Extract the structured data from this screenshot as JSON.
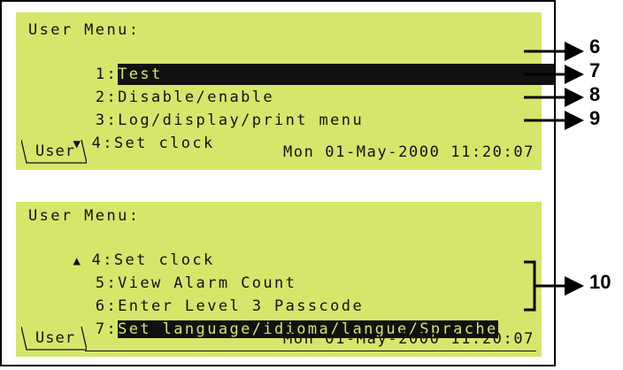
{
  "screen1": {
    "title": "User Menu:",
    "items": [
      {
        "num": "1:",
        "label": "Test",
        "selected": true
      },
      {
        "num": "2:",
        "label": "Disable/enable"
      },
      {
        "num": "3:",
        "label": "Log/display/print menu"
      },
      {
        "num": "4:",
        "label": "Set clock",
        "indicator": "▼"
      }
    ],
    "tab": "User",
    "datetime": "Mon 01-May-2000 11:20:07"
  },
  "screen2": {
    "title": "User Menu:",
    "items": [
      {
        "num": "4:",
        "label": "Set clock",
        "indicator": "▲"
      },
      {
        "num": "5:",
        "label": "View Alarm Count"
      },
      {
        "num": "6:",
        "label": "Enter Level 3 Passcode"
      },
      {
        "num": "7:",
        "label": "Set language/idioma/langue/Sprache",
        "selected": true
      }
    ],
    "tab": "User",
    "datetime": "Mon 01-May-2000 11:20:07"
  },
  "callouts": [
    "6",
    "7",
    "8",
    "9",
    "10"
  ],
  "colors": {
    "lcd_background": "#d6e66a",
    "text": "#111111",
    "highlight": "#111111"
  }
}
